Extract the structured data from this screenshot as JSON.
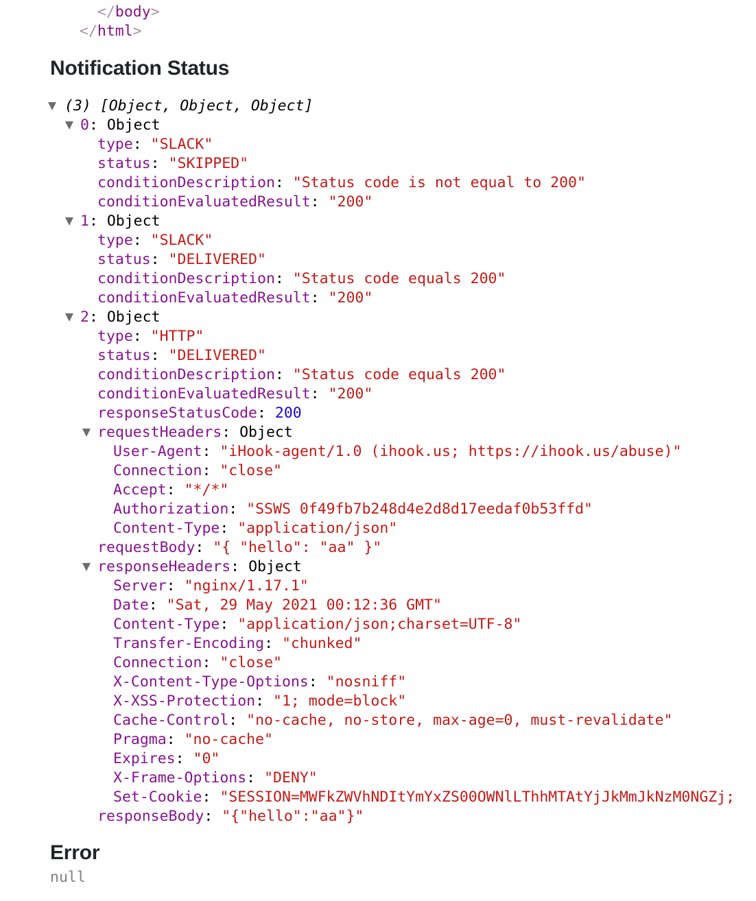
{
  "code_tail": {
    "lines": [
      {
        "indent": 142,
        "open": "</",
        "name": "body",
        "close": ">"
      },
      {
        "indent": 116,
        "open": "</",
        "name": "html",
        "close": ">"
      }
    ]
  },
  "notification_status": {
    "heading": "Notification Status",
    "root_summary": "(3) [Object, Object, Object]",
    "items": [
      {
        "index": "0",
        "type_label": "Object",
        "fields": [
          {
            "key": "type",
            "value": "\"SLACK\"",
            "kind": "str"
          },
          {
            "key": "status",
            "value": "\"SKIPPED\"",
            "kind": "str"
          },
          {
            "key": "conditionDescription",
            "value": "\"Status code is not equal to 200\"",
            "kind": "str"
          },
          {
            "key": "conditionEvaluatedResult",
            "value": "\"200\"",
            "kind": "str"
          }
        ]
      },
      {
        "index": "1",
        "type_label": "Object",
        "fields": [
          {
            "key": "type",
            "value": "\"SLACK\"",
            "kind": "str"
          },
          {
            "key": "status",
            "value": "\"DELIVERED\"",
            "kind": "str"
          },
          {
            "key": "conditionDescription",
            "value": "\"Status code equals 200\"",
            "kind": "str"
          },
          {
            "key": "conditionEvaluatedResult",
            "value": "\"200\"",
            "kind": "str"
          }
        ]
      },
      {
        "index": "2",
        "type_label": "Object",
        "fields": [
          {
            "key": "type",
            "value": "\"HTTP\"",
            "kind": "str"
          },
          {
            "key": "status",
            "value": "\"DELIVERED\"",
            "kind": "str"
          },
          {
            "key": "conditionDescription",
            "value": "\"Status code equals 200\"",
            "kind": "str"
          },
          {
            "key": "conditionEvaluatedResult",
            "value": "\"200\"",
            "kind": "str"
          },
          {
            "key": "responseStatusCode",
            "value": "200",
            "kind": "num"
          },
          {
            "key": "requestHeaders",
            "value": "Object",
            "kind": "object",
            "children": [
              {
                "key": "User-Agent",
                "value": "\"iHook-agent/1.0 (ihook.us; https://ihook.us/abuse)\"",
                "kind": "str"
              },
              {
                "key": "Connection",
                "value": "\"close\"",
                "kind": "str"
              },
              {
                "key": "Accept",
                "value": "\"*/*\"",
                "kind": "str"
              },
              {
                "key": "Authorization",
                "value": "\"SSWS 0f49fb7b248d4e2d8d17eedaf0b53ffd\"",
                "kind": "str"
              },
              {
                "key": "Content-Type",
                "value": "\"application/json\"",
                "kind": "str"
              }
            ]
          },
          {
            "key": "requestBody",
            "value": "\"{ \"hello\": \"aa\" }\"",
            "kind": "str"
          },
          {
            "key": "responseHeaders",
            "value": "Object",
            "kind": "object",
            "children": [
              {
                "key": "Server",
                "value": "\"nginx/1.17.1\"",
                "kind": "str"
              },
              {
                "key": "Date",
                "value": "\"Sat, 29 May 2021 00:12:36 GMT\"",
                "kind": "str"
              },
              {
                "key": "Content-Type",
                "value": "\"application/json;charset=UTF-8\"",
                "kind": "str"
              },
              {
                "key": "Transfer-Encoding",
                "value": "\"chunked\"",
                "kind": "str"
              },
              {
                "key": "Connection",
                "value": "\"close\"",
                "kind": "str"
              },
              {
                "key": "X-Content-Type-Options",
                "value": "\"nosniff\"",
                "kind": "str"
              },
              {
                "key": "X-XSS-Protection",
                "value": "\"1; mode=block\"",
                "kind": "str"
              },
              {
                "key": "Cache-Control",
                "value": "\"no-cache, no-store, max-age=0, must-revalidate\"",
                "kind": "str"
              },
              {
                "key": "Pragma",
                "value": "\"no-cache\"",
                "kind": "str"
              },
              {
                "key": "Expires",
                "value": "\"0\"",
                "kind": "str"
              },
              {
                "key": "X-Frame-Options",
                "value": "\"DENY\"",
                "kind": "str"
              },
              {
                "key": "Set-Cookie",
                "value": "\"SESSION=MWFkZWVhNDItYmYxZS00OWNlLThhMTAtYjJkMmJkNzM0NGZj;",
                "kind": "str"
              }
            ]
          },
          {
            "key": "responseBody",
            "value": "\"{\"hello\":\"aa\"}\"",
            "kind": "str"
          }
        ]
      }
    ]
  },
  "error": {
    "heading": "Error",
    "value": "null"
  },
  "colors": {
    "key": "#881391",
    "string": "#c41a16",
    "number": "#1c00cf",
    "heading": "#212529",
    "null": "#808080"
  }
}
